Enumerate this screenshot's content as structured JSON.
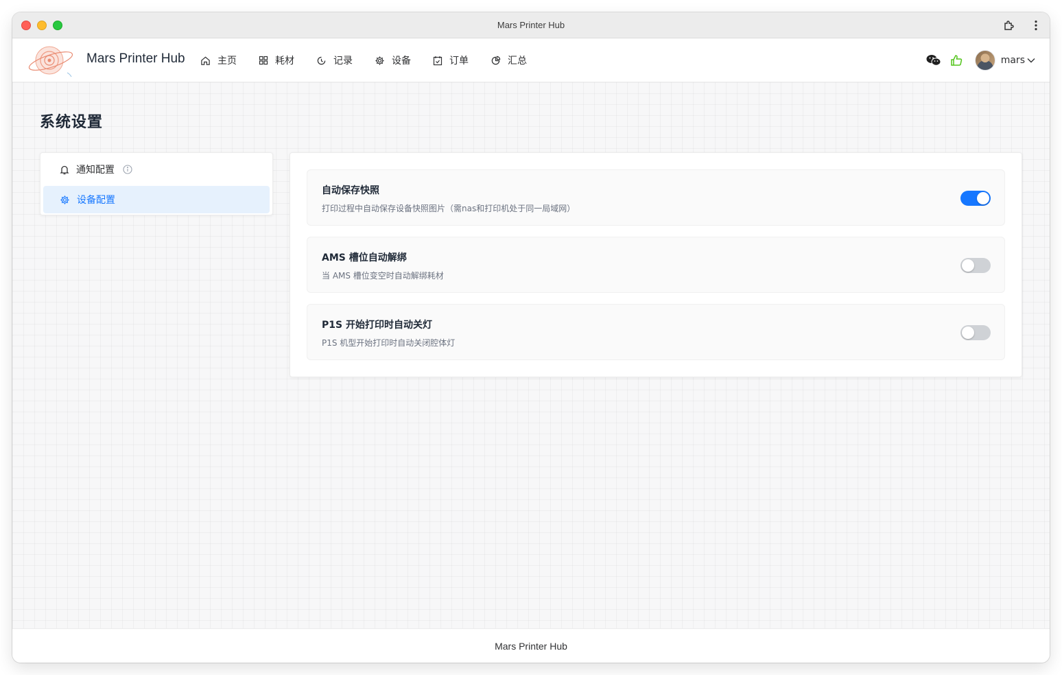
{
  "window": {
    "title": "Mars Printer Hub"
  },
  "header": {
    "brand": "Mars Printer Hub",
    "nav": [
      {
        "label": "主页",
        "icon": "home-icon"
      },
      {
        "label": "耗材",
        "icon": "grid-icon"
      },
      {
        "label": "记录",
        "icon": "history-icon"
      },
      {
        "label": "设备",
        "icon": "gear-icon"
      },
      {
        "label": "订单",
        "icon": "calendar-icon"
      },
      {
        "label": "汇总",
        "icon": "pie-chart-icon"
      }
    ],
    "user": {
      "name": "mars"
    }
  },
  "page": {
    "title": "系统设置"
  },
  "side_menu": {
    "items": [
      {
        "label": "通知配置",
        "icon": "bell-icon",
        "active": false
      },
      {
        "label": "设备配置",
        "icon": "gear-icon",
        "active": true
      }
    ]
  },
  "settings": [
    {
      "title": "自动保存快照",
      "desc": "打印过程中自动保存设备快照图片（需nas和打印机处于同一局域网）",
      "enabled": true
    },
    {
      "title": "AMS 槽位自动解绑",
      "desc": "当 AMS 槽位变空时自动解绑耗材",
      "enabled": false
    },
    {
      "title": "P1S 开始打印时自动关灯",
      "desc": "P1S 机型开始打印时自动关闭腔体灯",
      "enabled": false
    }
  ],
  "footer": {
    "text": "Mars Printer Hub"
  },
  "colors": {
    "accent": "#1677ff",
    "active_bg": "#e6f1fd",
    "thumbs_up": "#52c41a"
  }
}
